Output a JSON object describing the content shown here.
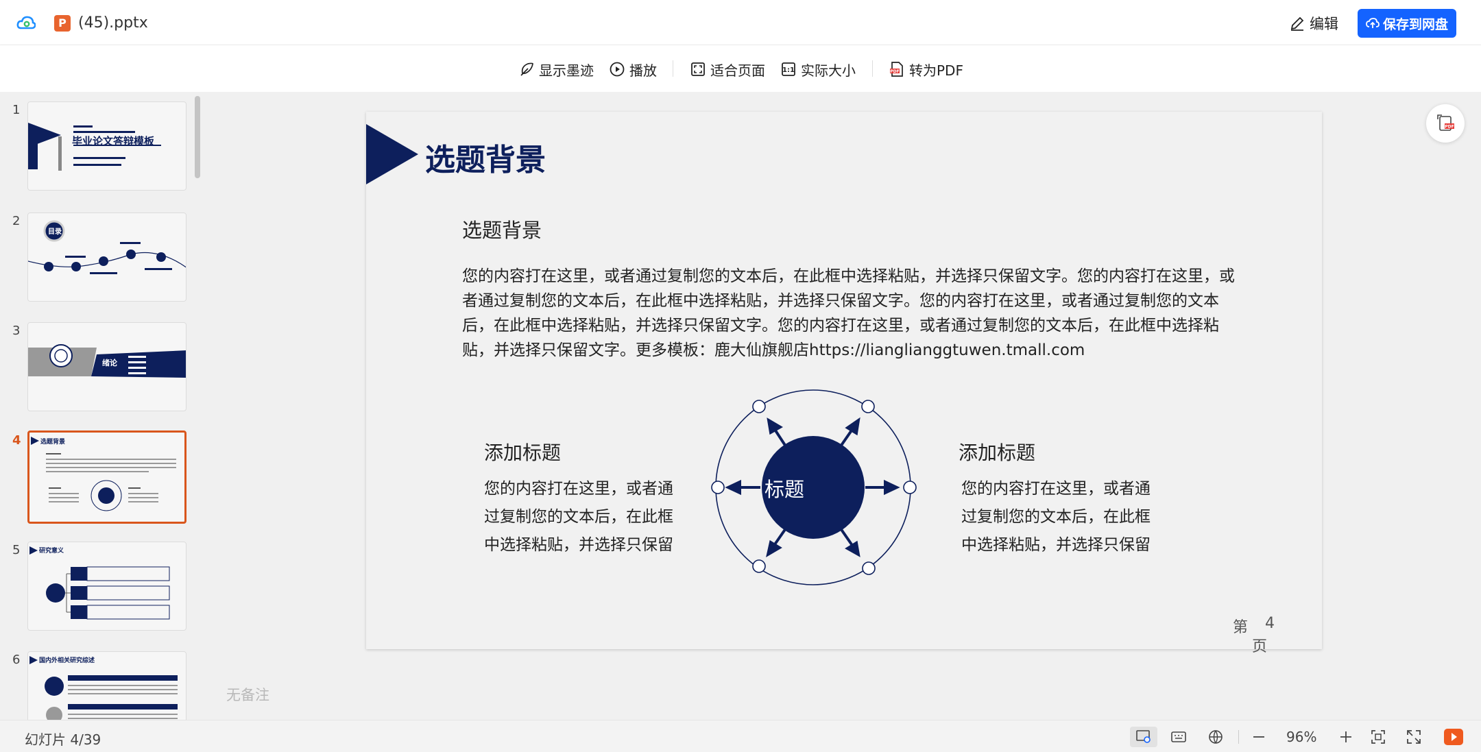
{
  "app": {
    "file_name": "(45).pptx",
    "file_badge": "P"
  },
  "header": {
    "edit_label": "编辑",
    "save_label": "保存到网盘",
    "accent": "#1463ff"
  },
  "toolbar": {
    "show_ink": "显示墨迹",
    "play": "播放",
    "fit_page": "适合页面",
    "actual_size": "实际大小",
    "to_pdf": "转为PDF"
  },
  "sidebar": {
    "slides": [
      {
        "num": "1",
        "title": "毕业论文答辩模板"
      },
      {
        "num": "2",
        "title": "目录"
      },
      {
        "num": "3",
        "title": "绪论"
      },
      {
        "num": "4",
        "title": "选题背景",
        "active": true
      },
      {
        "num": "5",
        "title": "研究意义"
      },
      {
        "num": "6",
        "title": "国内外相关研究综述"
      }
    ]
  },
  "slide": {
    "title": "选题背景",
    "subtitle": "选题背景",
    "body": "您的内容打在这里，或者通过复制您的文本后，在此框中选择粘贴，并选择只保留文字。您的内容打在这里，或者通过复制您的文本后，在此框中选择粘贴，并选择只保留文字。您的内容打在这里，或者通过复制您的文本后，在此框中选择粘贴，并选择只保留文字。您的内容打在这里，或者通过复制您的文本后，在此框中选择粘贴，并选择只保留文字。更多模板：鹿大仙旗舰店https://lianglianggtuwen.tmall.com",
    "left_heading": "添加标题",
    "left_text": "您的内容打在这里，或者通过复制您的文本后，在此框中选择粘贴，并选择只保留",
    "right_heading": "添加标题",
    "right_text": "您的内容打在这里，或者通过复制您的文本后，在此框中选择粘贴，并选择只保留",
    "hub_label": "标题",
    "page_prefix": "第",
    "page_number": "4",
    "page_suffix": "页",
    "theme_color": "#0d1f5c"
  },
  "notes": {
    "placeholder": "无备注"
  },
  "status": {
    "slide_counter": "幻灯片 4/39",
    "zoom": "96%"
  }
}
